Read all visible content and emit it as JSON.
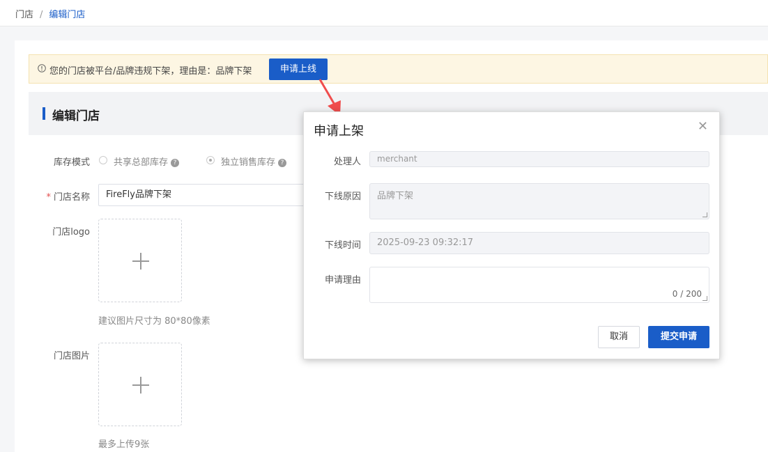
{
  "breadcrumb": {
    "root": "门店",
    "separator": "/",
    "current": "编辑门店"
  },
  "notice": {
    "icon": "info-circle-icon",
    "text": "您的门店被平台/品牌违规下架，理由是：品牌下架",
    "button_label": "申请上线"
  },
  "section": {
    "title": "编辑门店"
  },
  "form": {
    "stock_mode": {
      "label": "库存模式",
      "options": [
        "共享总部库存",
        "独立销售库存"
      ],
      "selected": "独立销售库存"
    },
    "store_name": {
      "required_mark": "*",
      "label": "门店名称",
      "value": "FireFly品牌下架"
    },
    "store_logo": {
      "label": "门店logo",
      "hint": "建议图片尺寸为 80*80像素"
    },
    "store_images": {
      "label": "门店图片",
      "hint": "最多上传9张"
    }
  },
  "modal": {
    "title": "申请上架",
    "close_icon": "close-icon",
    "handler_label": "处理人",
    "handler_value": "merchant",
    "reason_label": "下线原因",
    "reason_value": "品牌下架",
    "time_label": "下线时间",
    "time_value": "2025-09-23 09:32:17",
    "apply_reason_label": "申请理由",
    "apply_reason_value": "",
    "counter": "0 / 200",
    "cancel_label": "取消",
    "submit_label": "提交申请"
  },
  "colors": {
    "primary": "#1a5dc8",
    "notice_bg": "#fdf6e3",
    "arrow": "#f04d4d"
  }
}
